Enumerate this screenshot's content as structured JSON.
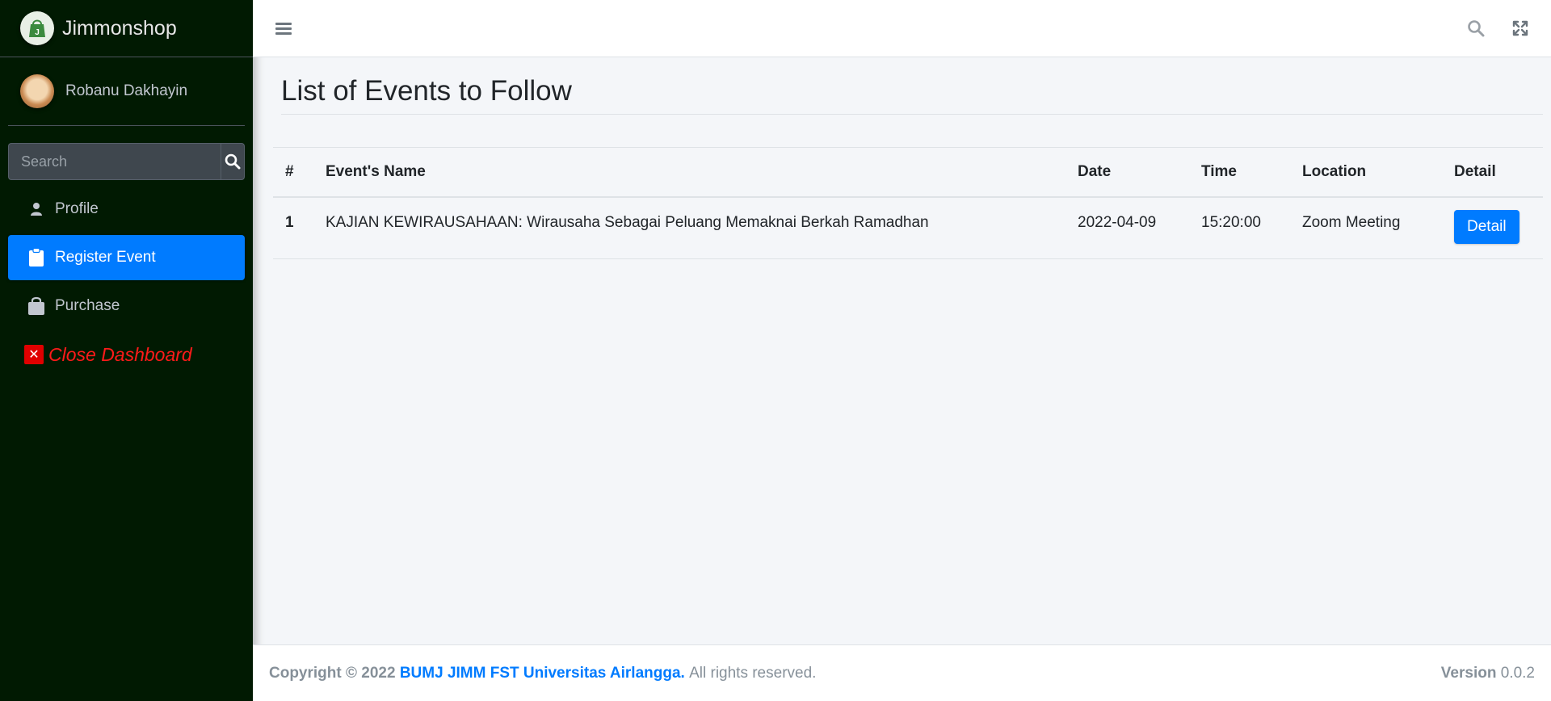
{
  "brand": {
    "title": "Jimmonshop"
  },
  "user": {
    "name": "Robanu Dakhayin"
  },
  "search": {
    "placeholder": "Search"
  },
  "sidebar": {
    "items": [
      {
        "label": "Profile",
        "icon": "user-icon"
      },
      {
        "label": "Register Event",
        "icon": "clipboard-icon",
        "active": true
      },
      {
        "label": "Purchase",
        "icon": "shopping-bag-icon"
      },
      {
        "label": "Close Dashboard",
        "icon": "close-icon"
      }
    ]
  },
  "main": {
    "title": "List of Events to Follow",
    "table": {
      "headers": [
        "#",
        "Event's Name",
        "Date",
        "Time",
        "Location",
        "Detail"
      ],
      "rows": [
        {
          "no": "1",
          "name": "KAJIAN KEWIRAUSAHAAN: Wirausaha Sebagai Peluang Memaknai Berkah Ramadhan",
          "date": "2022-04-09",
          "time": "15:20:00",
          "location": "Zoom Meeting",
          "detail_label": "Detail"
        }
      ]
    }
  },
  "footer": {
    "copyright_prefix": "Copyright © 2022",
    "org": "BUMJ JIMM FST Universitas Airlangga.",
    "rights": "All rights reserved.",
    "version_label": "Version",
    "version_value": "0.0.2"
  },
  "colors": {
    "sidebar_bg": "#011a02",
    "accent": "#007bff",
    "danger": "#ff1a1a"
  }
}
